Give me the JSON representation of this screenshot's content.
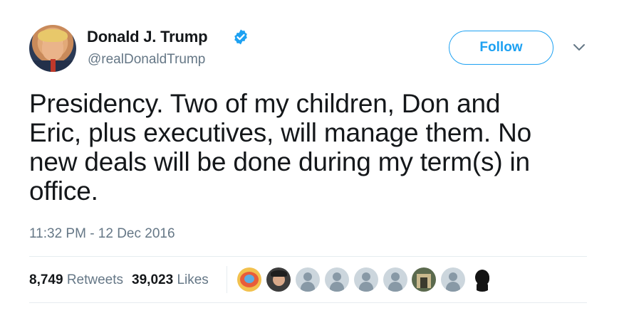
{
  "author": {
    "name": "Donald J. Trump",
    "handle": "@realDonaldTrump",
    "verified": true
  },
  "follow_button": {
    "label": "Follow"
  },
  "tweet": {
    "lines": [
      "Presidency. Two of my children, Don and",
      "Eric, plus executives, will manage them. No",
      "new deals will be done during my term(s) in",
      "office."
    ],
    "timestamp": "11:32 PM - 12 Dec 2016"
  },
  "stats": {
    "retweets_count": "8,749",
    "retweets_label": "Retweets",
    "likes_count": "39,023",
    "likes_label": "Likes"
  },
  "likers": [
    {
      "kind": "photo",
      "icon": "cartoon-avatar-icon"
    },
    {
      "kind": "photo",
      "icon": "person-photo-icon"
    },
    {
      "kind": "default",
      "icon": "default-avatar-icon"
    },
    {
      "kind": "default",
      "icon": "default-avatar-icon"
    },
    {
      "kind": "default",
      "icon": "default-avatar-icon"
    },
    {
      "kind": "default",
      "icon": "default-avatar-icon"
    },
    {
      "kind": "photo",
      "icon": "building-photo-icon"
    },
    {
      "kind": "default",
      "icon": "default-avatar-icon"
    },
    {
      "kind": "silhouette",
      "icon": "silhouette-avatar-icon"
    }
  ],
  "colors": {
    "accent": "#1da1f2",
    "text": "#14171a",
    "muted": "#657786",
    "divider": "#e6ecf0"
  }
}
